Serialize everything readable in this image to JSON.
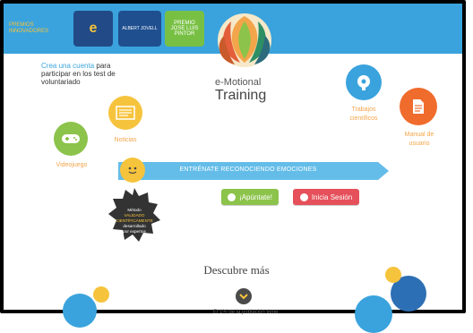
{
  "top_logos": {
    "logo1": {
      "line1": "PREMIOS",
      "line2": "INNOVADORES"
    },
    "logo2": {
      "letter": "e"
    },
    "logo3": {
      "name": "ALBERT JOVELL"
    },
    "logo4": {
      "line1": "PREMIO",
      "line2": "JOSE LUIS",
      "line3": "PINTOR"
    }
  },
  "brand": {
    "line1": "e-Motional",
    "line2": "Training"
  },
  "signup": {
    "link": "Crea una cuenta",
    "rest": " para participar en los test de voluntariado"
  },
  "nav": {
    "noticias": "Noticias",
    "videojuego": "Videojuego",
    "trabajos": "Trabajos científicos",
    "manual": "Manual de usuario"
  },
  "banner": {
    "text": "ENTRÉNATE RECONOCIENDO EMOCIONES"
  },
  "buttons": {
    "signup": "¡Apúntate!",
    "login": "Inicia Sesión"
  },
  "seal": {
    "line1": "Método",
    "line2": "VALIDADO",
    "line3": "CIENTÍFICAMENTE",
    "line4": "desarrollado",
    "line5": "por expertos"
  },
  "discover": {
    "title": "Descubre más",
    "footer": "El 1% de la población tiene"
  },
  "colors": {
    "blue": "#3aa3dd",
    "orange": "#f2a54a",
    "green": "#8cc34b",
    "red": "#e5505a",
    "yellow": "#f6c33c"
  }
}
